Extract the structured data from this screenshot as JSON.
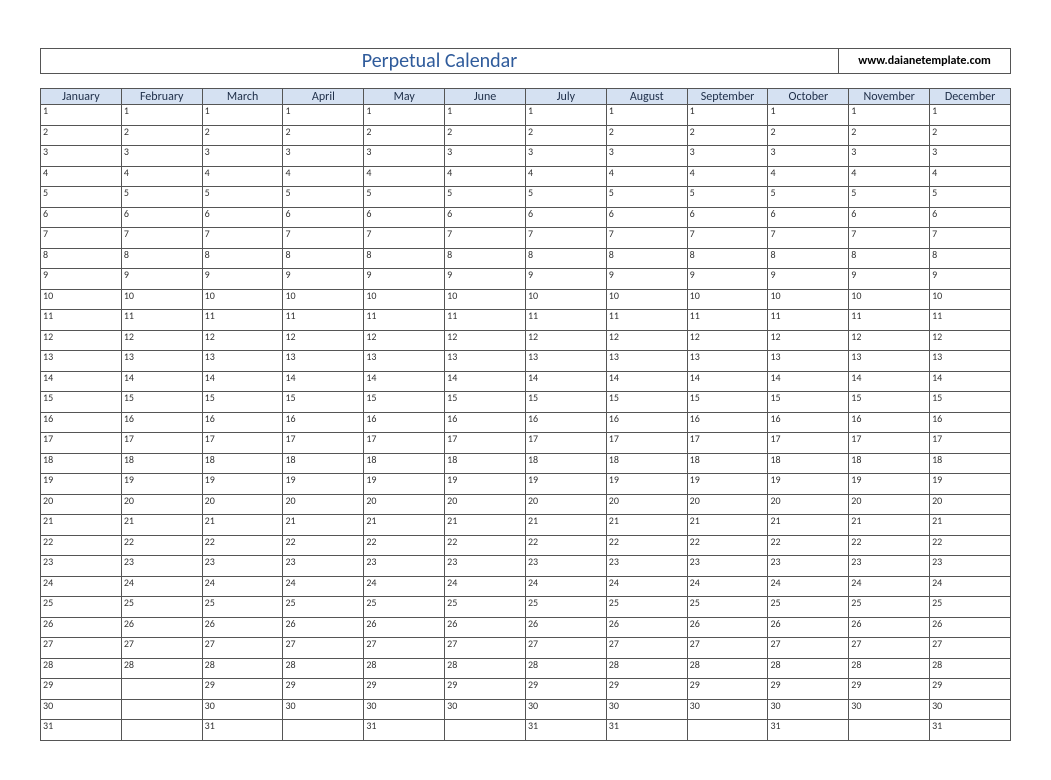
{
  "title": "Perpetual Calendar",
  "website": "www.daianetemplate.com",
  "colors": {
    "title_text": "#2f5b9b",
    "header_bg": "#d5e1f2",
    "border": "#555555"
  },
  "chart_data": {
    "type": "table",
    "title": "Perpetual Calendar",
    "months": [
      {
        "name": "January",
        "days": 31
      },
      {
        "name": "February",
        "days": 28
      },
      {
        "name": "March",
        "days": 31
      },
      {
        "name": "April",
        "days": 30
      },
      {
        "name": "May",
        "days": 31
      },
      {
        "name": "June",
        "days": 30
      },
      {
        "name": "July",
        "days": 31
      },
      {
        "name": "August",
        "days": 31
      },
      {
        "name": "September",
        "days": 30
      },
      {
        "name": "October",
        "days": 31
      },
      {
        "name": "November",
        "days": 30
      },
      {
        "name": "December",
        "days": 31
      }
    ],
    "max_days": 31
  }
}
